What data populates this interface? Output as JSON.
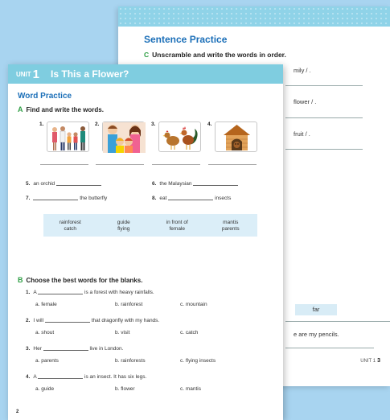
{
  "back_page": {
    "title": "Sentence Practice",
    "section_c": {
      "letter": "C",
      "instruction": "Unscramble and write the words in order."
    },
    "fragments": [
      "mily / .",
      "flower / .",
      "fruit / ."
    ],
    "word_far": "far",
    "bottom_text": "e are my pencils.",
    "footer_unit": "UNIT 1",
    "footer_page": "3"
  },
  "front_page": {
    "unit_label": "UNIT",
    "unit_number": "1",
    "unit_title": "Is This a Flower?",
    "word_practice": "Word Practice",
    "section_a": {
      "letter": "A",
      "instruction": "Find and write the words."
    },
    "pictures": [
      "1.",
      "2.",
      "3.",
      "4."
    ],
    "fill_items": [
      {
        "num": "5.",
        "before": "an orchid",
        "after": ""
      },
      {
        "num": "6.",
        "before": "the Malaysian",
        "after": ""
      },
      {
        "num": "7.",
        "before": "",
        "after": "the butterfly"
      },
      {
        "num": "8.",
        "before": "eat",
        "after": "insects"
      }
    ],
    "word_bank": [
      "rainforest",
      "guide",
      "in front of",
      "mantis",
      "catch",
      "flying",
      "female",
      "parents"
    ],
    "section_b": {
      "letter": "B",
      "instruction": "Choose the best words for the blanks."
    },
    "questions": [
      {
        "num": "1.",
        "before": "A",
        "after": "is a forest with heavy rainfalls.",
        "options": [
          "a. female",
          "b. rainforest",
          "c. mountain"
        ]
      },
      {
        "num": "2.",
        "before": "I will",
        "after": "that dragonfly with my hands.",
        "options": [
          "a. shout",
          "b. visit",
          "c. catch"
        ]
      },
      {
        "num": "3.",
        "before": "Her",
        "after": "live in London.",
        "options": [
          "a. parents",
          "b. rainforests",
          "c. flying insects"
        ]
      },
      {
        "num": "4.",
        "before": "A",
        "after": "is an insect. It has six legs.",
        "options": [
          "a. guide",
          "b. flower",
          "c. mantis"
        ]
      }
    ],
    "page_number": "2"
  }
}
